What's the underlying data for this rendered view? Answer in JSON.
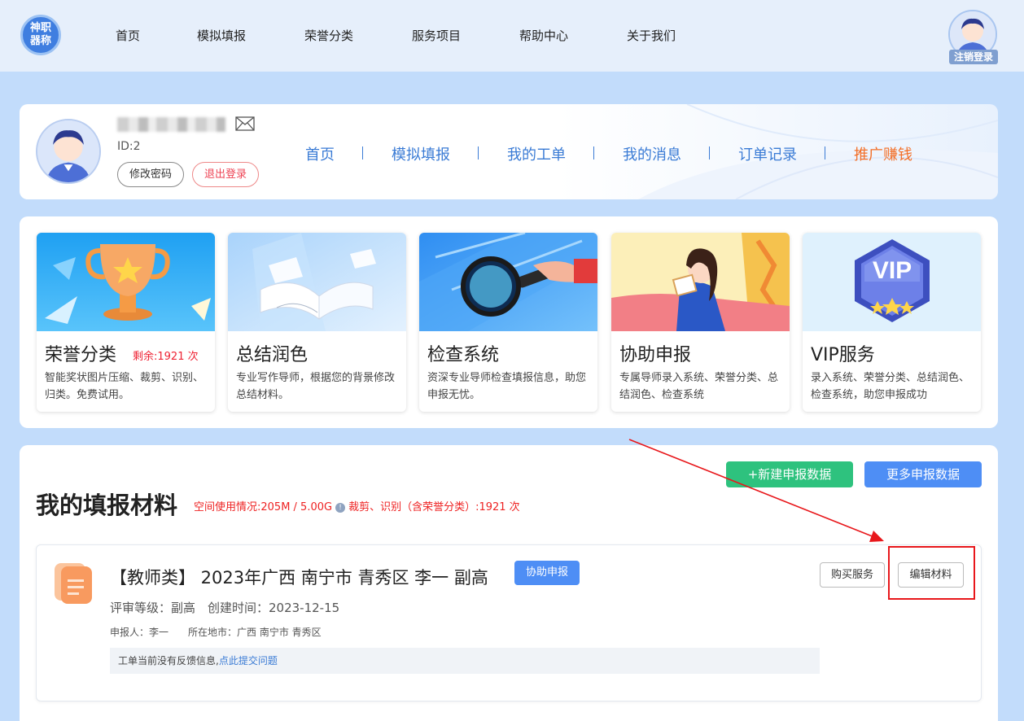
{
  "brand": {
    "logo_line1": "神职",
    "logo_line2": "器称"
  },
  "topnav": {
    "items": [
      "首页",
      "模拟填报",
      "荣誉分类",
      "服务项目",
      "帮助中心",
      "关于我们"
    ],
    "logout_label": "注销登录"
  },
  "profile": {
    "user_id": "ID:2",
    "change_password": "修改密码",
    "logout": "退出登录",
    "nav": [
      "首页",
      "模拟填报",
      "我的工单",
      "我的消息",
      "订单记录",
      "推广赚钱"
    ]
  },
  "services": [
    {
      "title": "荣誉分类",
      "remain": "剩余:1921 次",
      "desc": "智能奖状图片压缩、裁剪、识别、归类。免费试用。"
    },
    {
      "title": "总结润色",
      "remain": "",
      "desc": "专业写作导师，根据您的背景修改总结材料。"
    },
    {
      "title": "检查系统",
      "remain": "",
      "desc": "资深专业导师检查填报信息，助您申报无忧。"
    },
    {
      "title": "协助申报",
      "remain": "",
      "desc": "专属导师录入系统、荣誉分类、总结润色、检查系统"
    },
    {
      "title": "VIP服务",
      "remain": "",
      "desc": "录入系统、荣誉分类、总结润色、检查系统，助您申报成功"
    }
  ],
  "vip_badge": "VIP",
  "materials": {
    "title": "我的填报材料",
    "usage_space": "空间使用情况:205M / 5.00G",
    "usage_ops": "裁剪、识别（含荣誉分类）:1921 次",
    "new_button": "+新建申报数据",
    "more_button": "更多申报数据",
    "record": {
      "title": "【教师类】 2023年广西 南宁市 青秀区 李一 副高",
      "tag": "协助申报",
      "meta": "评审等级：副高　创建时间：2023-12-15",
      "meta2": "申报人：李一　　所在地市：广西 南宁市 青秀区",
      "feedback_text": "工单当前没有反馈信息,",
      "feedback_link": "点此提交问题",
      "buy_button": "购买服务",
      "edit_button": "编辑材料"
    }
  },
  "colors": {
    "page_bg": "#c2dcfb",
    "accent_blue": "#4e8ef5",
    "accent_green": "#2ec27e",
    "promo_orange": "#f36f28",
    "highlight_red": "#e8171b"
  }
}
